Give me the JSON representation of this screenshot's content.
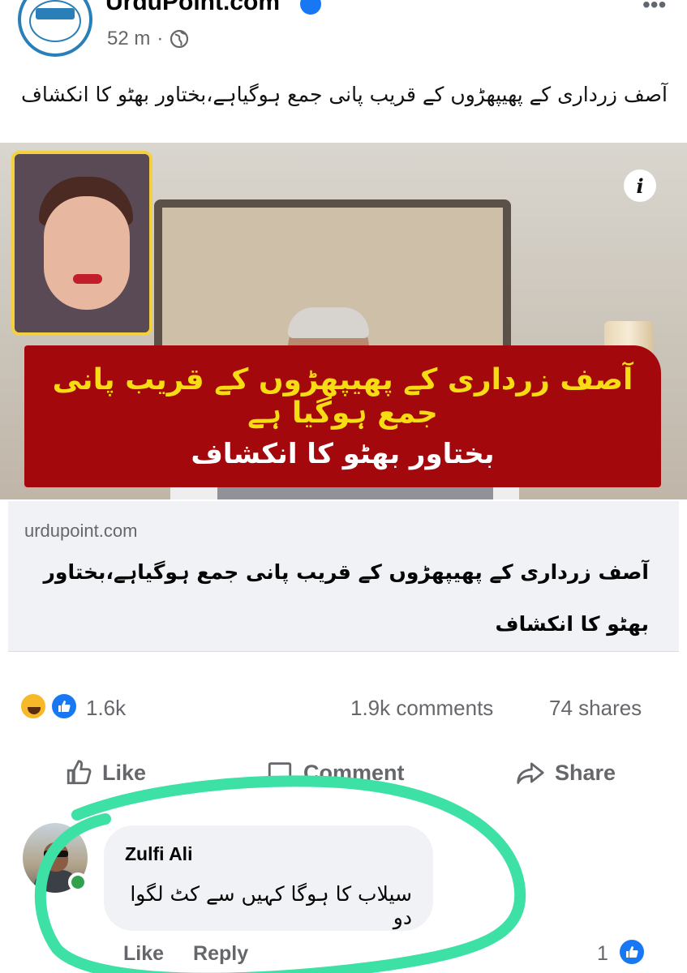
{
  "header": {
    "page_name": "UrduPoint.com",
    "time": "52 m",
    "separator": "·"
  },
  "post": {
    "caption": "آصف زرداری کے پھیپھڑوں کے قریب پانی جمع ہوگیاہے،بختاور بھٹو کا انکشاف"
  },
  "media": {
    "banner_line1": "آصف زرداری کے پھیپھڑوں کے قریب پانی جمع ہوگیا ہے",
    "banner_line2": "بختاور بھٹو کا انکشاف",
    "info_label": "i"
  },
  "link_preview": {
    "domain": "urdupoint.com",
    "title": "آصف زرداری کے پھیپھڑوں کے قریب پانی جمع ہوگیاہے،بختاور بھٹو کا انکشاف"
  },
  "stats": {
    "reactions": "1.6k",
    "comments": "1.9k comments",
    "shares": "74 shares"
  },
  "actions": {
    "like": "Like",
    "comment": "Comment",
    "share": "Share"
  },
  "comment": {
    "author": "Zulfi Ali",
    "text": "سیلاب کا ہوگا کہیں سے کٹ لگوا دو",
    "like_link": "Like",
    "reply_link": "Reply",
    "like_count": "1"
  },
  "colors": {
    "facebook_blue": "#1877f2",
    "banner_red": "#a3080c",
    "banner_yellow": "#f7dc14",
    "highlight_green": "#3de0a5",
    "online_green": "#31a24c"
  }
}
